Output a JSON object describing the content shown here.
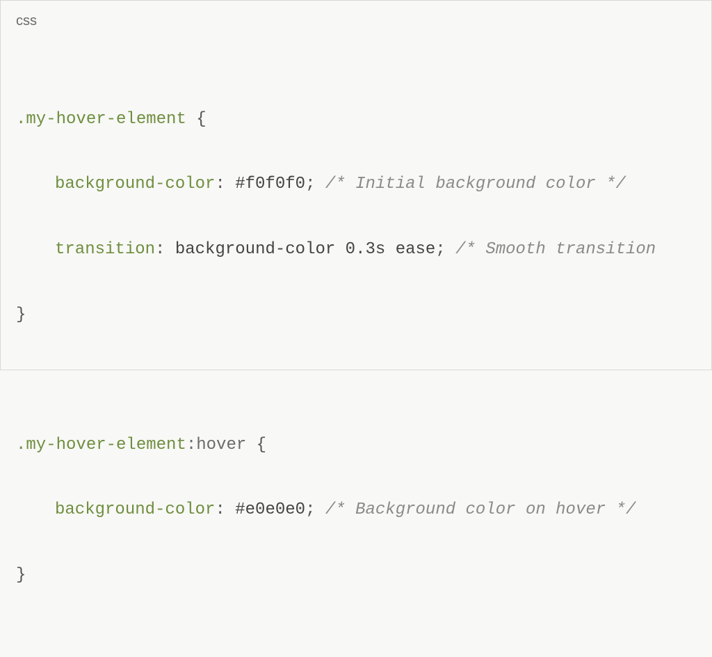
{
  "langLabel": "css",
  "code": {
    "blankTop": " ",
    "rule1": {
      "selector": ".my-hover-element",
      "openBrace": " {",
      "decl1": {
        "prop": "background-color",
        "colon": ":",
        "space": " ",
        "value": "#f0f0f0",
        "semi": ";",
        "commentSpace": " ",
        "comment": "/* Initial background color */"
      },
      "decl2": {
        "prop": "transition",
        "colon": ":",
        "space": " ",
        "value": "background-color 0.3s ease",
        "semi": ";",
        "commentSpace": " ",
        "comment": "/* Smooth transition"
      },
      "closeBrace": "}"
    },
    "blankMid": " ",
    "rule2": {
      "selector": ".my-hover-element",
      "pseudo": ":hover",
      "openBrace": " {",
      "decl1": {
        "prop": "background-color",
        "colon": ":",
        "space": " ",
        "value": "#e0e0e0",
        "semi": ";",
        "commentSpace": " ",
        "comment": "/* Background color on hover */"
      },
      "closeBrace": "}"
    }
  }
}
